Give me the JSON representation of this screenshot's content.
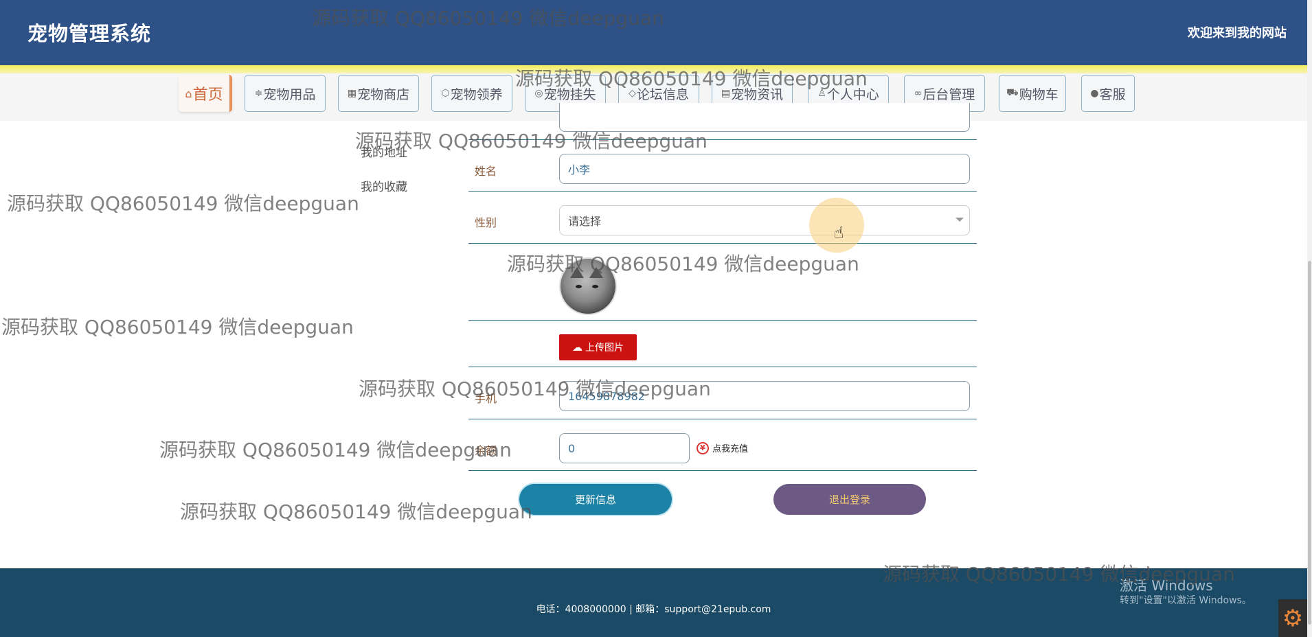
{
  "header": {
    "title": "宠物管理系统",
    "welcome": "欢迎来到我的网站"
  },
  "nav": [
    {
      "label": "首页",
      "icon": "⌂"
    },
    {
      "label": "宠物用品",
      "icon": "≑"
    },
    {
      "label": "宠物商店",
      "icon": "▦"
    },
    {
      "label": "宠物领养",
      "icon": "⬡"
    },
    {
      "label": "宠物挂失",
      "icon": "◎"
    },
    {
      "label": "论坛信息",
      "icon": "◇"
    },
    {
      "label": "宠物资讯",
      "icon": "▤"
    },
    {
      "label": "个人中心",
      "icon": "♙"
    },
    {
      "label": "后台管理",
      "icon": "∞"
    },
    {
      "label": "购物车",
      "icon": "⛟"
    },
    {
      "label": "客服",
      "icon": "●"
    }
  ],
  "side_menu": [
    "我的地址",
    "我的收藏"
  ],
  "form": {
    "name_label": "姓名",
    "name_value": "小李",
    "gender_label": "性别",
    "gender_value": "请选择",
    "upload_label": "上传图片",
    "phone_label": "手机",
    "phone_value": "16459878982",
    "balance_label": "余额",
    "balance_value": "0",
    "recharge_label": "点我充值"
  },
  "buttons": {
    "update": "更新信息",
    "logout": "退出登录"
  },
  "footer": {
    "text": "电话：4008000000 | 邮箱：support@21epub.com"
  },
  "windows": {
    "title": "激活 Windows",
    "subtitle": "转到\"设置\"以激活 Windows。"
  },
  "watermark": "源码获取 QQ86050149 微信deepguan"
}
